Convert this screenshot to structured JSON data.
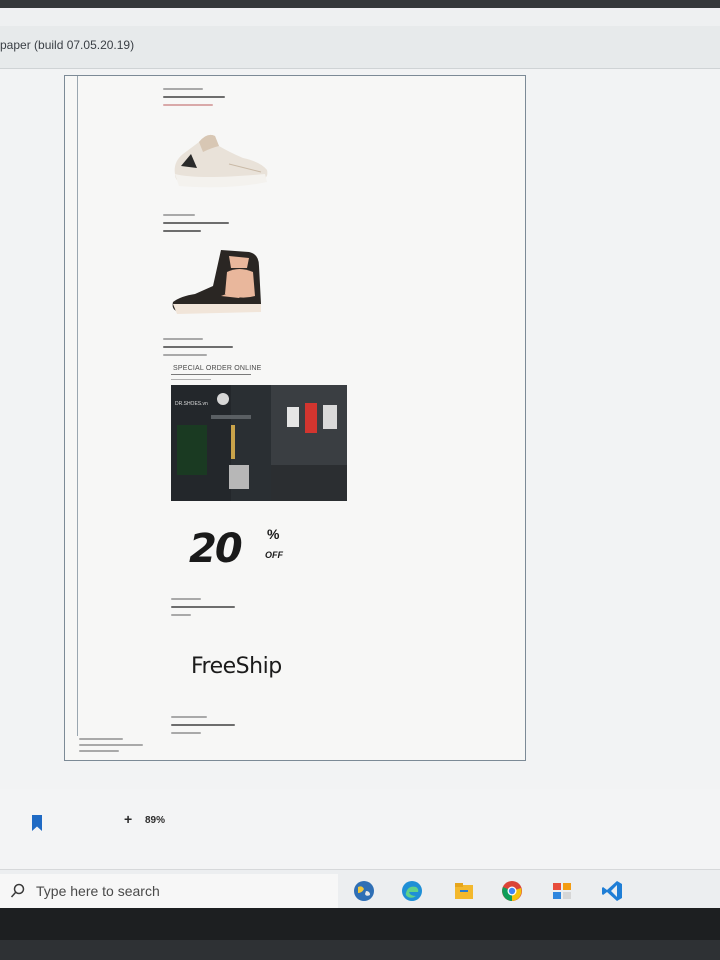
{
  "window": {
    "title": "paper (build 07.05.20.19)"
  },
  "document": {
    "special_order_heading": "SPECIAL ORDER ONLINE",
    "store_photo_label": "DR.SHOES.vn",
    "discount": {
      "number": "20",
      "percent_sign": "%",
      "off_label": "OFF"
    },
    "freeship_label": "FreeShip"
  },
  "statusbar": {
    "zoom_plus": "+",
    "zoom_level": "89%"
  },
  "taskbar": {
    "search_placeholder": "Type here to search",
    "icons": [
      "app-icon-globe",
      "edge-icon",
      "file-explorer-icon",
      "chrome-icon",
      "office-icon",
      "vscode-icon"
    ]
  },
  "colors": {
    "accent_blue": "#1f6ac4",
    "page_border": "#7c8a96"
  }
}
